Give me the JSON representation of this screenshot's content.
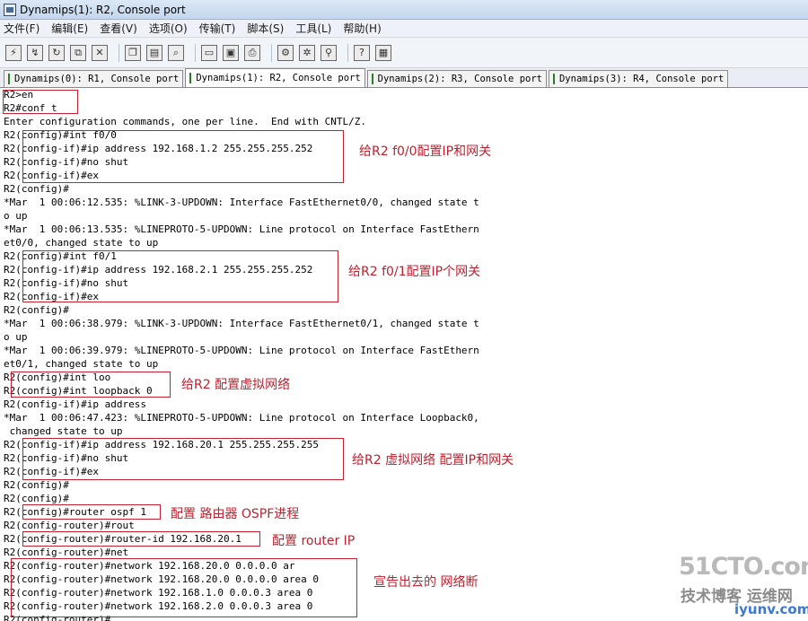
{
  "window": {
    "title": "Dynamips(1): R2, Console port"
  },
  "menu": [
    "文件(F)",
    "编辑(E)",
    "查看(V)",
    "选项(O)",
    "传输(T)",
    "脚本(S)",
    "工具(L)",
    "帮助(H)"
  ],
  "tabs": [
    "Dynamips(0): R1, Console port",
    "Dynamips(1): R2, Console port",
    "Dynamips(2): R3, Console port",
    "Dynamips(3): R4, Console port"
  ],
  "console": {
    "lines": [
      "R2>en",
      "R2#conf t",
      "Enter configuration commands, one per line.  End with CNTL/Z.",
      "R2(config)#int f0/0",
      "R2(config-if)#ip address 192.168.1.2 255.255.255.252",
      "R2(config-if)#no shut",
      "R2(config-if)#ex",
      "R2(config)#",
      "*Mar  1 00:06:12.535: %LINK-3-UPDOWN: Interface FastEthernet0/0, changed state t",
      "o up",
      "*Mar  1 00:06:13.535: %LINEPROTO-5-UPDOWN: Line protocol on Interface FastEthern",
      "et0/0, changed state to up",
      "R2(config)#int f0/1",
      "R2(config-if)#ip address 192.168.2.1 255.255.255.252",
      "R2(config-if)#no shut",
      "R2(config-if)#ex",
      "R2(config)#",
      "*Mar  1 00:06:38.979: %LINK-3-UPDOWN: Interface FastEthernet0/1, changed state t",
      "o up",
      "*Mar  1 00:06:39.979: %LINEPROTO-5-UPDOWN: Line protocol on Interface FastEthern",
      "et0/1, changed state to up",
      "R2(config)#int loo",
      "R2(config)#int loopback 0",
      "R2(config-if)#ip address",
      "*Mar  1 00:06:47.423: %LINEPROTO-5-UPDOWN: Line protocol on Interface Loopback0,",
      " changed state to up",
      "R2(config-if)#ip address 192.168.20.1 255.255.255.255",
      "R2(config-if)#no shut",
      "R2(config-if)#ex",
      "R2(config)#",
      "R2(config)#",
      "R2(config)#router ospf 1",
      "R2(config-router)#rout",
      "R2(config-router)#router-id 192.168.20.1",
      "R2(config-router)#net",
      "R2(config-router)#network 192.168.20.0 0.0.0.0 ar",
      "R2(config-router)#network 192.168.20.0 0.0.0.0 area 0",
      "R2(config-router)#network 192.168.1.0 0.0.0.3 area 0",
      "R2(config-router)#network 192.168.2.0 0.0.0.3 area 0",
      "R2(config-router)#"
    ]
  },
  "annotations": [
    "给R2 f0/0配置IP和网关",
    "给R2 f0/1配置IP个网关",
    "给R2 配置虚拟网络",
    "给R2 虚拟网络 配置IP和网关",
    "配置 路由器 OSPF进程",
    "配置 router IP",
    "宣告出去的 网络断"
  ],
  "watermark": {
    "line1": "51CTO.com",
    "line2": "技术博客  运维网",
    "line3": "iyunv.com"
  },
  "colors": {
    "annotation": "#c0202e",
    "titlebar": "#c3d6ee"
  }
}
